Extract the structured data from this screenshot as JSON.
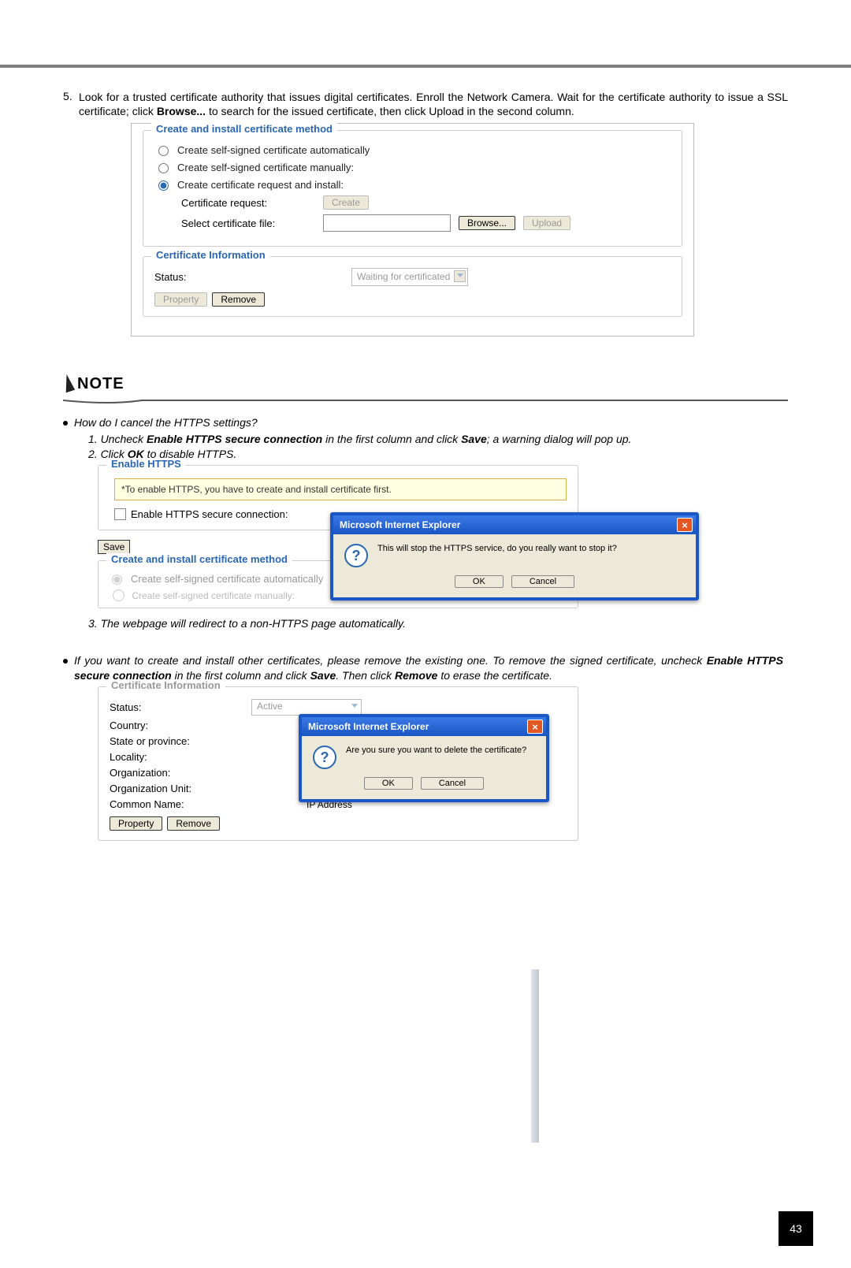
{
  "step5": {
    "num": "5.",
    "text_prefix": "Look for a trusted certificate authority that issues digital certificates. Enroll the Network Camera. Wait for the certificate authority to issue a SSL certificate; click ",
    "browse": "Browse...",
    "text_suffix": " to search for the issued certificate, then click Upload in the second column."
  },
  "panel1": {
    "legend": "Create and install certificate method",
    "opt1": "Create self-signed certificate automatically",
    "opt2": "Create self-signed certificate manually:",
    "opt3": "Create certificate request and install:",
    "cert_req_label": "Certificate request:",
    "create_btn": "Create",
    "select_file_label": "Select certificate file:",
    "browse_btn": "Browse...",
    "upload_btn": "Upload",
    "cert_info_legend": "Certificate Information",
    "status_label": "Status:",
    "status_value": "Waiting for certificated",
    "property_btn": "Property",
    "remove_btn": "Remove"
  },
  "note_label": "NOTE",
  "q1": "How do I cancel the HTTPS settings?",
  "q1_step1_pre": "1. Uncheck ",
  "q1_step1_bold1": "Enable HTTPS secure connection",
  "q1_step1_mid": " in the first column and click ",
  "q1_step1_bold2": "Save",
  "q1_step1_suffix": "; a warning dialog will pop up.",
  "q1_step2_pre": "2. Click ",
  "q1_step2_bold": "OK",
  "q1_step2_suffix": " to disable HTTPS.",
  "panel2": {
    "legend": "Enable HTTPS",
    "hint": "*To enable HTTPS, you have to create and install certificate first.",
    "checkbox_label": "Enable HTTPS secure connection:",
    "save_btn": "Save",
    "method_legend": "Create and install certificate method",
    "method_opt1": "Create self-signed certificate automatically",
    "method_cut": "Create self-signed certificate manually:"
  },
  "dialog1": {
    "title": "Microsoft Internet Explorer",
    "msg": "This will stop the HTTPS service, do you really want to stop it?",
    "ok": "OK",
    "cancel": "Cancel"
  },
  "q1_step3": "3. The webpage will redirect to a non-HTTPS page automatically.",
  "q2_pre": "If you want to create and install other certificates, please remove the existing one. To remove the signed certificate, uncheck ",
  "q2_bold1": "Enable HTTPS secure connection",
  "q2_mid1": " in the first column and click ",
  "q2_bold2": "Save",
  "q2_mid2": ". Then click ",
  "q2_bold3": "Remove",
  "q2_suffix": " to erase the certificate.",
  "panel3": {
    "legend": "Certificate Information",
    "status_label": "Status:",
    "status_value": "Active",
    "country_label": "Country:",
    "state_label": "State or province:",
    "locality_label": "Locality:",
    "org_label": "Organization:",
    "orgunit_label": "Organization Unit:",
    "common_label": "Common Name:",
    "common_value": "IP Address",
    "property_btn": "Property",
    "remove_btn": "Remove"
  },
  "dialog2": {
    "title": "Microsoft Internet Explorer",
    "msg": "Are you sure you want to delete the certificate?",
    "ok": "OK",
    "cancel": "Cancel"
  },
  "page_number": "43"
}
